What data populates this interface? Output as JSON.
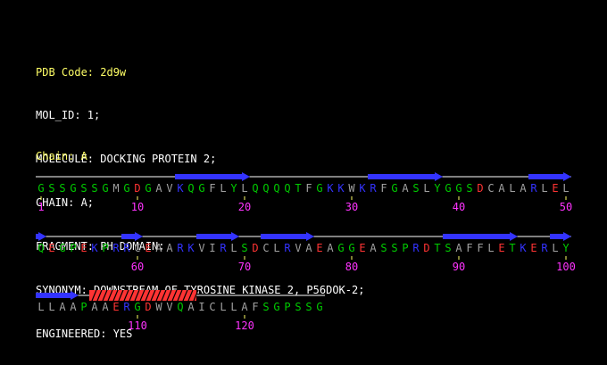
{
  "header": {
    "pdb_code": "PDB Code: 2d9w",
    "lines": [
      "MOL_ID: 1;",
      "MOLECULE: DOCKING PROTEIN 2;",
      "CHAIN: A;",
      "FRAGMENT: PH DOMAIN;",
      "SYNONYM: DOWNSTREAM OF TYROSINE KINASE 2, P56DOK-2;",
      "ENGINEERED: YES"
    ]
  },
  "chain_label": "Chain: A",
  "sequence": "GSSGSSGMGDGAVKQGFLYLQQQQTFGKKWKRFGASLYGGSDCALARLELQEGPEKPRRCEAARKVIRLSDCLRVAEAGGEASSPRDTSAFFLETKERLYLLAAPAAERGDWVQAICLLAFSGPSSG",
  "residue_colors": {
    "hydrophobic": "#a0a0a0",
    "polar": "#00cc00",
    "acidic": "#ff3333",
    "basic": "#3333ff",
    "number": "#ff33ff",
    "strand": "#3333ff",
    "helix": "#ff3333",
    "coil": "#ffffff"
  },
  "tick_labels": [
    "1",
    "10",
    "20",
    "30",
    "40",
    "50",
    "60",
    "70",
    "80",
    "90",
    "100",
    "110",
    "120"
  ],
  "tick_positions": [
    1,
    10,
    20,
    30,
    40,
    50,
    60,
    70,
    80,
    90,
    100,
    110,
    120
  ],
  "secondary_structure": [
    {
      "type": "strand",
      "start": 14,
      "end": 20
    },
    {
      "type": "strand",
      "start": 32,
      "end": 38
    },
    {
      "type": "strand",
      "start": 47,
      "end": 50
    },
    {
      "type": "strand",
      "start": 51,
      "end": 51
    },
    {
      "type": "strand",
      "start": 59,
      "end": 60
    },
    {
      "type": "strand",
      "start": 66,
      "end": 69
    },
    {
      "type": "strand",
      "start": 72,
      "end": 76
    },
    {
      "type": "strand",
      "start": 89,
      "end": 95
    },
    {
      "type": "strand",
      "start": 99,
      "end": 100
    },
    {
      "type": "strand",
      "start": 101,
      "end": 104
    },
    {
      "type": "helix",
      "start": 106,
      "end": 115
    }
  ]
}
